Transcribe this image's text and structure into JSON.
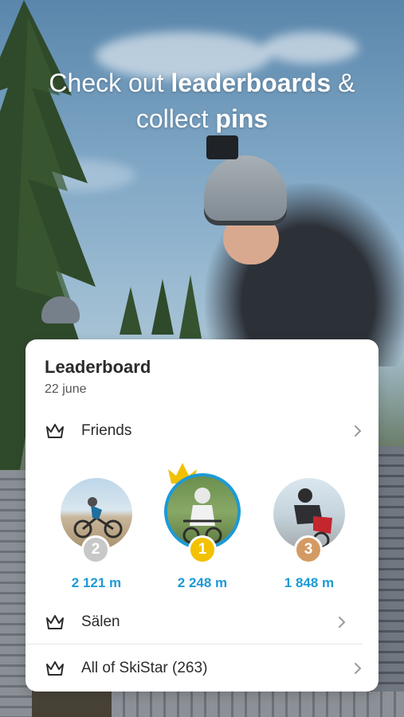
{
  "headline": {
    "part1": "Check out ",
    "bold1": "leaderboards",
    "part2": " &",
    "part3": "collect ",
    "bold2": "pins"
  },
  "card": {
    "title": "Leaderboard",
    "date": "22 june",
    "friends_label": "Friends",
    "salen_label": "Sälen",
    "all_label": "All of SkiStar (263)"
  },
  "podium": [
    {
      "rank": "2",
      "distance": "2 121 m",
      "badge_color": "#c8c8c8"
    },
    {
      "rank": "1",
      "distance": "2 248 m",
      "badge_color": "#f2c100"
    },
    {
      "rank": "3",
      "distance": "1 848 m",
      "badge_color": "#d49a64"
    }
  ],
  "colors": {
    "accent_blue": "#1d9ad6",
    "gold": "#f2c100",
    "silver": "#c8c8c8",
    "bronze": "#d49a64"
  },
  "icons": {
    "row_icon": "crown-outline-icon",
    "chevron": "chevron-right-icon",
    "winner": "gold-crown-icon"
  }
}
